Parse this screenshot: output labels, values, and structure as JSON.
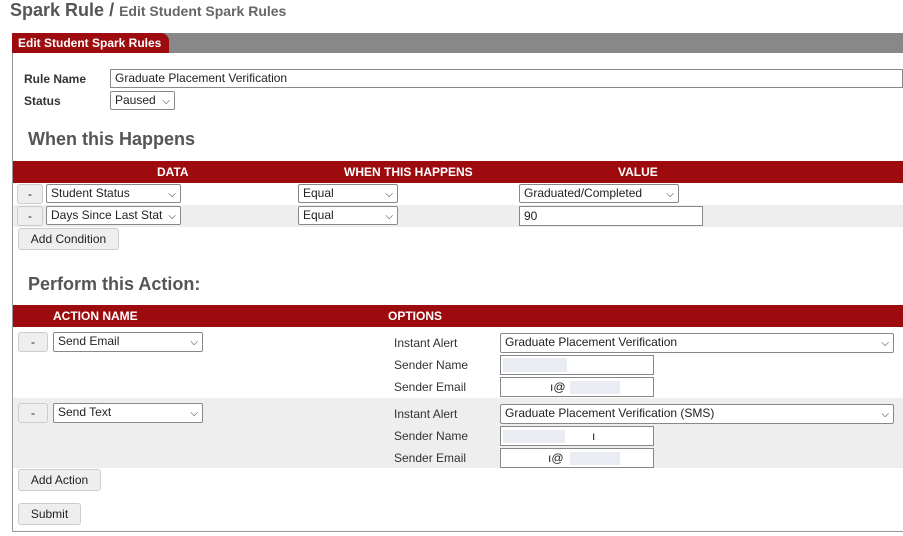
{
  "header": {
    "title": "Spark Rule",
    "separator": "/",
    "subtitle": "Edit Student Spark Rules"
  },
  "panel": {
    "tab_label": "Edit Student Spark Rules"
  },
  "form": {
    "rule_name_label": "Rule Name",
    "rule_name_value": "Graduate Placement Verification",
    "status_label": "Status",
    "status_value": "Paused"
  },
  "conditions": {
    "heading": "When this Happens",
    "columns": {
      "data": "DATA",
      "when": "WHEN THIS HAPPENS",
      "value": "VALUE"
    },
    "rows": [
      {
        "remove": "-",
        "data": "Student Status",
        "operator": "Equal",
        "value": "Graduated/Completed",
        "value_type": "select"
      },
      {
        "remove": "-",
        "data": "Days Since Last Stat",
        "operator": "Equal",
        "value": "90",
        "value_type": "input"
      }
    ],
    "add_button": "Add Condition"
  },
  "actions": {
    "heading": "Perform this Action:",
    "columns": {
      "name": "ACTION NAME",
      "options": "OPTIONS"
    },
    "rows": [
      {
        "remove": "-",
        "name": "Send Email",
        "instant_alert_label": "Instant Alert",
        "instant_alert_value": "Graduate Placement Verification",
        "sender_name_label": "Sender Name",
        "sender_name_value": "",
        "sender_email_label": "Sender Email",
        "sender_email_value": "ı@"
      },
      {
        "remove": "-",
        "name": "Send Text",
        "instant_alert_label": "Instant Alert",
        "instant_alert_value": "Graduate Placement Verification (SMS)",
        "sender_name_label": "Sender Name",
        "sender_name_value": "ı",
        "sender_email_label": "Sender Email",
        "sender_email_value": "ı@"
      }
    ],
    "add_button": "Add Action"
  },
  "submit_label": "Submit",
  "colors": {
    "brand": "#9e0b0f",
    "panel_bar": "#888888"
  },
  "icons": {
    "select_arrow": "chevron-down-icon"
  }
}
